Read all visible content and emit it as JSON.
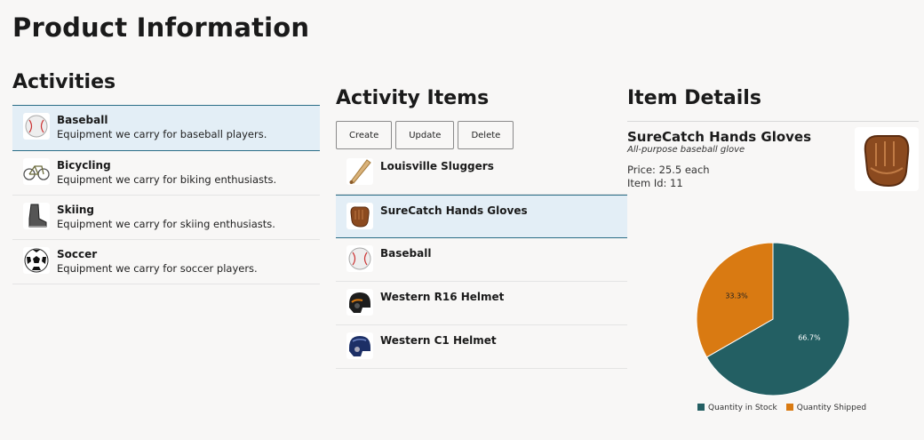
{
  "page": {
    "title": "Product Information"
  },
  "activities": {
    "title": "Activities",
    "items": [
      {
        "name": "Baseball",
        "desc": "Equipment we carry for baseball players.",
        "icon": "baseball-icon",
        "selected": true
      },
      {
        "name": "Bicycling",
        "desc": "Equipment we carry for biking enthusiasts.",
        "icon": "bicycle-icon",
        "selected": false
      },
      {
        "name": "Skiing",
        "desc": "Equipment we carry for skiing enthusiasts.",
        "icon": "ski-boot-icon",
        "selected": false
      },
      {
        "name": "Soccer",
        "desc": "Equipment we carry for soccer players.",
        "icon": "soccer-ball-icon",
        "selected": false
      }
    ]
  },
  "activity_items": {
    "title": "Activity Items",
    "toolbar": {
      "create": "Create",
      "update": "Update",
      "delete": "Delete"
    },
    "items": [
      {
        "name": "Louisville Sluggers",
        "icon": "bat-icon"
      },
      {
        "name": "SureCatch Hands Gloves",
        "icon": "glove-icon",
        "selected": true
      },
      {
        "name": "Baseball",
        "icon": "baseball-icon"
      },
      {
        "name": "Western R16 Helmet",
        "icon": "helmet-icon"
      },
      {
        "name": "Western C1 Helmet",
        "icon": "helmet-blue-icon"
      }
    ]
  },
  "item_details": {
    "title": "Item Details",
    "name": "SureCatch Hands Gloves",
    "subtitle": "All-purpose baseball glove",
    "price": "Price: 25.5 each",
    "item_id": "Item Id: 11"
  },
  "chart_data": {
    "type": "pie",
    "series": [
      {
        "name": "Quantity in Stock",
        "value": 66.7,
        "label": "66.7%",
        "color": "#235f63"
      },
      {
        "name": "Quantity Shipped",
        "value": 33.3,
        "label": "33.3%",
        "color": "#d97a12"
      }
    ],
    "legend": "bottom"
  }
}
